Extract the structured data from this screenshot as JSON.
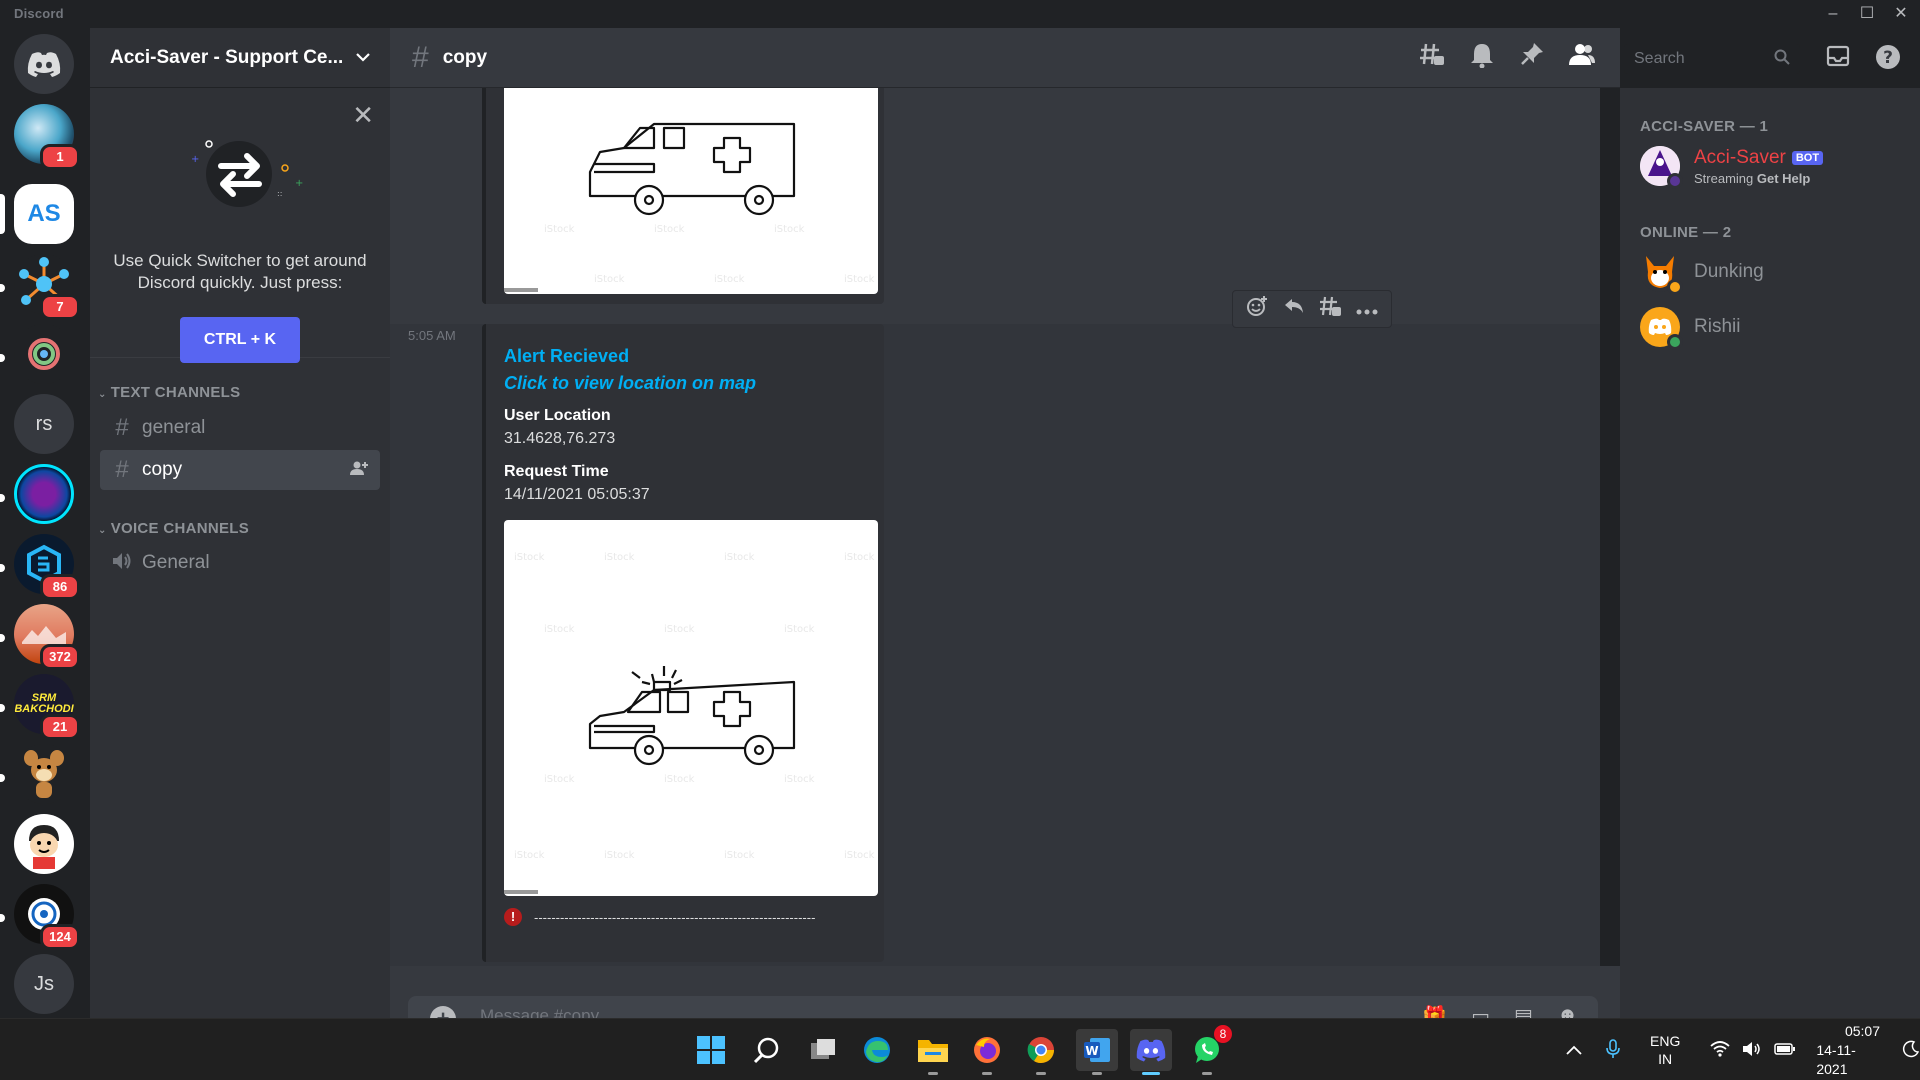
{
  "window": {
    "app_name": "Discord",
    "controls": [
      "–",
      "☐",
      "✕"
    ]
  },
  "server_rail": {
    "servers": [
      {
        "label": "",
        "badge": "",
        "kind": "discord-home"
      },
      {
        "label": "",
        "badge": "1",
        "kind": "avatar"
      },
      {
        "label": "AS",
        "badge": "",
        "kind": "selected"
      },
      {
        "label": "",
        "badge": "7",
        "kind": "avatar"
      },
      {
        "label": "",
        "badge": "",
        "kind": "avatar"
      },
      {
        "label": "rs",
        "badge": "",
        "kind": "text"
      },
      {
        "label": "",
        "badge": "",
        "kind": "avatar"
      },
      {
        "label": "",
        "badge": "86",
        "kind": "avatar"
      },
      {
        "label": "",
        "badge": "372",
        "kind": "avatar"
      },
      {
        "label": "SRM BAKCHODI",
        "badge": "21",
        "kind": "avatar"
      },
      {
        "label": "",
        "badge": "",
        "kind": "avatar"
      },
      {
        "label": "",
        "badge": "",
        "kind": "avatar"
      },
      {
        "label": "",
        "badge": "124",
        "kind": "avatar"
      },
      {
        "label": "Js",
        "badge": "",
        "kind": "text"
      }
    ]
  },
  "sidebar": {
    "server_name": "Acci-Saver - Support Ce...",
    "quick_switcher": {
      "text": "Use Quick Switcher to get around Discord quickly. Just press:",
      "button": "CTRL + K"
    },
    "categories": [
      {
        "name": "TEXT CHANNELS",
        "channels": [
          "general",
          "copy"
        ]
      },
      {
        "name": "VOICE CHANNELS",
        "channels": [
          "General"
        ]
      }
    ]
  },
  "header": {
    "channel": "copy",
    "search_placeholder": "Search"
  },
  "message": {
    "timestamp": "5:05 AM",
    "embed": {
      "title": "Alert Recieved",
      "link": "Click to view location on map",
      "fields": [
        {
          "name": "User Location",
          "value": "31.4628,76.273"
        },
        {
          "name": "Request Time",
          "value": "14/11/2021 05:05:37"
        }
      ],
      "footer_text": "-----------------------------------------------------------------"
    }
  },
  "composer": {
    "placeholder": "Message #copy"
  },
  "members": {
    "groups": [
      {
        "title": "ACCI-SAVER — 1",
        "members": [
          {
            "name": "Acci-Saver",
            "tag": "BOT",
            "activity_prefix": "Streaming",
            "activity": "Get Help"
          }
        ]
      },
      {
        "title": "ONLINE — 2",
        "members": [
          {
            "name": "Dunking"
          },
          {
            "name": "Rishii"
          }
        ]
      }
    ]
  },
  "taskbar": {
    "lang": "ENG",
    "region": "IN",
    "time": "05:07",
    "date": "14-11-2021",
    "whatsapp_badge": "8"
  },
  "colors": {
    "accent": "#5865f2",
    "link": "#00aff4",
    "danger": "#ed4245",
    "online": "#3ba55d"
  }
}
